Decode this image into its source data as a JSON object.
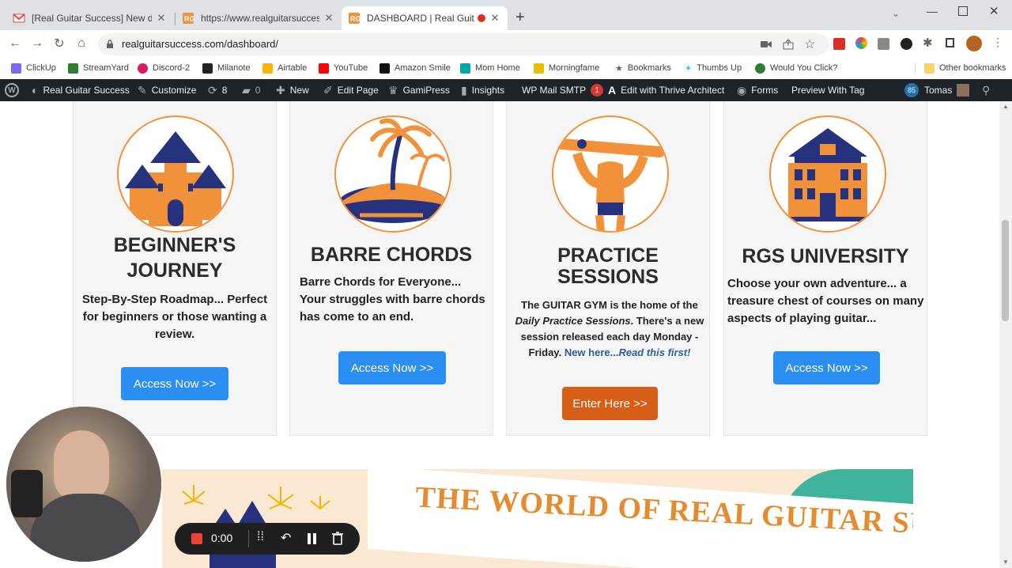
{
  "tabs": [
    {
      "title": "[Real Guitar Success] New discus",
      "icon": "gmail-icon"
    },
    {
      "title": "https://www.realguitarsuccess.co",
      "icon": "rgs-favicon"
    },
    {
      "title": "DASHBOARD | Real Guitar Su",
      "icon": "rgs-favicon"
    }
  ],
  "new_tab": "+",
  "address": {
    "url": "realguitarsuccess.com/dashboard/"
  },
  "bookmarks": [
    {
      "label": "ClickUp",
      "color": "#7b68ee"
    },
    {
      "label": "StreamYard",
      "color": "#2e7d32"
    },
    {
      "label": "Discord-2",
      "color": "#d81b60"
    },
    {
      "label": "Milanote",
      "color": "#222222"
    },
    {
      "label": "Airtable",
      "color": "#fcb400"
    },
    {
      "label": "YouTube",
      "color": "#ff0000"
    },
    {
      "label": "Amazon Smile",
      "color": "#111111"
    },
    {
      "label": "Mom Home",
      "color": "#00a8a8"
    },
    {
      "label": "Morningfame",
      "color": "#e2c100"
    },
    {
      "label": "Bookmarks",
      "color": "#5f6368"
    },
    {
      "label": "Thumbs Up",
      "color": "#29b6f6"
    },
    {
      "label": "Would You Click?",
      "color": "#2e7d32"
    }
  ],
  "other_bookmarks": "Other bookmarks",
  "wpbar": {
    "site": "Real Guitar Success",
    "customize": "Customize",
    "updates": "8",
    "comments": "0",
    "new": "New",
    "edit_page": "Edit Page",
    "gamipress": "GamiPress",
    "insights": "Insights",
    "mail": "WP Mail SMTP",
    "mail_badge": "1",
    "thrive": "Edit with Thrive Architect",
    "forms": "Forms",
    "preview": "Preview With Tag",
    "user_badge": "85",
    "user": "Tomas"
  },
  "cards": [
    {
      "title1": "BEGINNER'S",
      "title2": "JOURNEY",
      "desc": "Step-By-Step Roadmap... Perfect for beginners or those wanting a review.",
      "button": "Access Now >>",
      "image": "castle-icon"
    },
    {
      "title1": "BARRE CHORDS",
      "desc": "Barre Chords for Everyone... Your struggles with barre chords has come to an end.",
      "button": "Access Now >>",
      "image": "island-icon"
    },
    {
      "title1": "PRACTICE",
      "title2": "SESSIONS",
      "desc_a": "The GUITAR GYM is the home of the",
      "desc_b": "Daily Practice Sessions",
      "desc_c": ". There's a new session released each day Monday - Friday.",
      "link_a": "New here...",
      "link_b": "Read this first!",
      "button": "Enter Here >>",
      "image": "strongman-guitar-icon"
    },
    {
      "title1": "RGS UNIVERSITY",
      "desc": "Choose your own adventure... a treasure chest of courses on many aspects of playing guitar...",
      "button": "Access Now >>",
      "image": "university-icon"
    }
  ],
  "banner": {
    "text": "THE WORLD OF REAL GUITAR SUCCESS"
  },
  "recorder": {
    "time": "0:00"
  },
  "colors": {
    "accent_blue": "#2b8ef2",
    "accent_orange": "#d65e17",
    "brand_orange": "#f1913a",
    "navy": "#27327e"
  }
}
